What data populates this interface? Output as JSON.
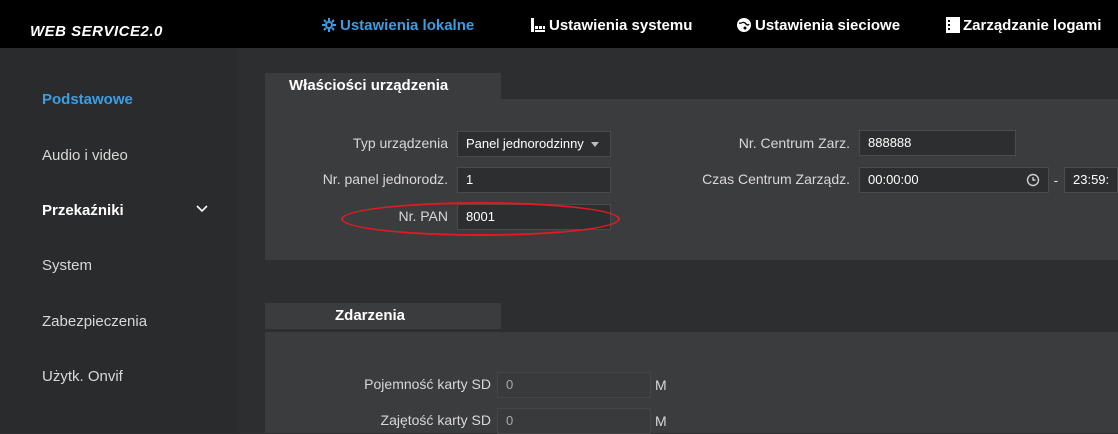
{
  "header": {
    "logo": "WEB SERVICE2.0",
    "nav": [
      {
        "label": "Ustawienia lokalne",
        "icon": "gear-icon"
      },
      {
        "label": "Ustawienia systemu",
        "icon": "grid-icon"
      },
      {
        "label": "Ustawienia sieciowe",
        "icon": "globe-icon"
      },
      {
        "label": "Zarządzanie logami",
        "icon": "log-icon"
      }
    ],
    "active_color": "#3b9de3"
  },
  "sidebar": {
    "items": [
      {
        "label": "Podstawowe"
      },
      {
        "label": "Audio i video"
      },
      {
        "label": "Przekaźniki"
      },
      {
        "label": "System"
      },
      {
        "label": "Zabezpieczenia"
      },
      {
        "label": "Użytk. Onvif"
      }
    ]
  },
  "device_section": {
    "tab": "Właściości urządzenia",
    "device_type_label": "Typ urządzenia",
    "device_type_value": "Panel jednorodzinny",
    "panel_no_label": "Nr. panel jednorodz.",
    "panel_no_value": "1",
    "pan_label": "Nr. PAN",
    "pan_value": "8001",
    "center_no_label": "Nr. Centrum Zarz.",
    "center_no_value": "888888",
    "center_time_label": "Czas Centrum Zarządz.",
    "center_time_start": "00:00:00",
    "center_time_dash": "-",
    "center_time_end": "23:59:"
  },
  "events_section": {
    "tab": "Zdarzenia",
    "sd_capacity_label": "Pojemność karty SD",
    "sd_capacity_value": "0",
    "sd_capacity_unit": "M",
    "sd_used_label": "Zajętość karty SD",
    "sd_used_value": "0",
    "sd_used_unit": "M"
  },
  "annotation_color": "#e11b22"
}
